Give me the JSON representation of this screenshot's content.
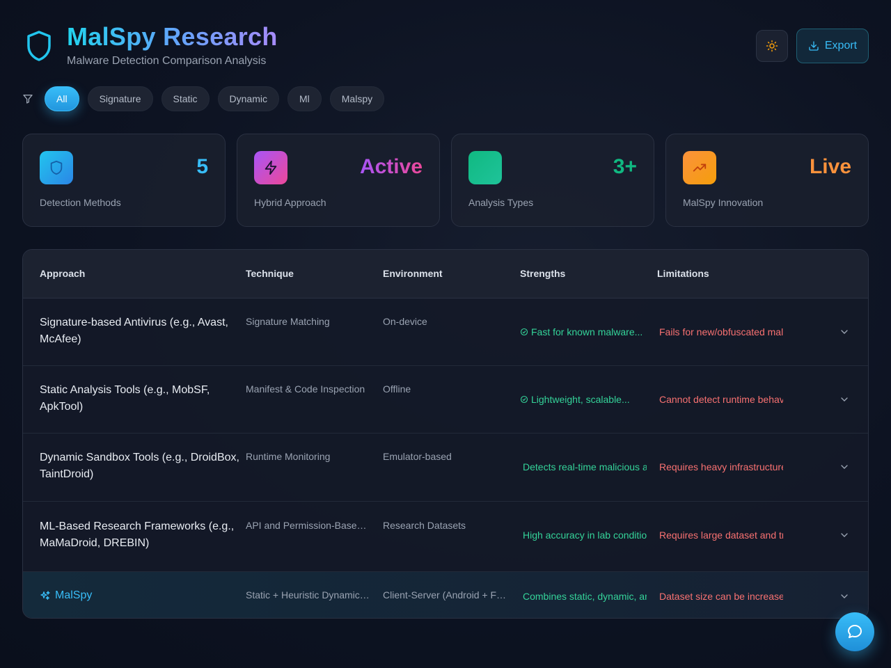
{
  "header": {
    "title": "MalSpy Research",
    "subtitle": "Malware Detection Comparison Analysis",
    "export_label": "Export"
  },
  "filters": [
    "All",
    "Signature",
    "Static",
    "Dynamic",
    "Ml",
    "Malspy"
  ],
  "active_filter": "All",
  "stats": [
    {
      "value": "5",
      "label": "Detection Methods",
      "icon": "shield-icon",
      "color": "#38bdf8"
    },
    {
      "value": "Active",
      "label": "Hybrid Approach",
      "icon": "lightning-icon",
      "color": "#c056d9"
    },
    {
      "value": "3+",
      "label": "Analysis Types",
      "icon": "",
      "color": "#10b981"
    },
    {
      "value": "Live",
      "label": "MalSpy Innovation",
      "icon": "trending-up-icon",
      "color": "#fb923c"
    }
  ],
  "table": {
    "headers": {
      "approach": "Approach",
      "technique": "Technique",
      "environment": "Environment",
      "strengths": "Strengths",
      "limitations": "Limitations"
    },
    "rows": [
      {
        "approach": "Signature-based Antivirus (e.g., Avast, McAfee)",
        "technique": "Signature Matching",
        "environment": "On-device",
        "strengths": "Fast for known malware...",
        "limitations": "Fails for new/obfuscated malware"
      },
      {
        "approach": "Static Analysis Tools (e.g., MobSF, ApkTool)",
        "technique": "Manifest & Code Inspection",
        "environment": "Offline",
        "strengths": "Lightweight, scalable...",
        "limitations": "Cannot detect runtime behavior"
      },
      {
        "approach": "Dynamic Sandbox Tools (e.g., DroidBox, TaintDroid)",
        "technique": "Runtime Monitoring",
        "environment": "Emulator-based",
        "strengths": "Detects real-time malicious activity",
        "limitations": "Requires heavy infrastructure"
      },
      {
        "approach": "ML-Based Research Frameworks (e.g., MaMaDroid, DREBIN)",
        "technique": "API and Permission-Based ML",
        "environment": "Research Datasets",
        "strengths": "High accuracy in lab conditions",
        "limitations": "Requires large dataset and training"
      },
      {
        "approach": "MalSpy",
        "technique": "Static + Heuristic Dynamic Analysis",
        "environment": "Client-Server (Android + Flask)",
        "strengths": "Combines static, dynamic, and ML",
        "limitations": "Dataset size can be increased"
      }
    ]
  },
  "colors": {
    "accent": "#38bdf8",
    "success": "#34d399",
    "danger": "#f87171"
  }
}
